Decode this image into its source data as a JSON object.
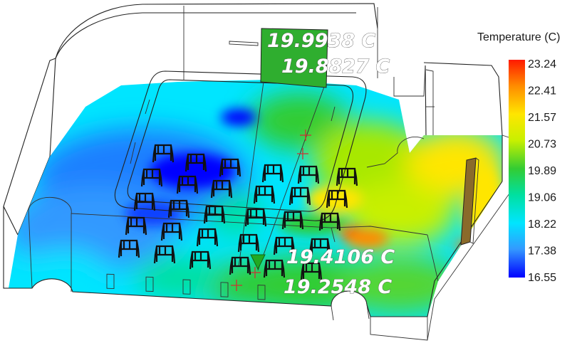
{
  "legend": {
    "title": "Temperature (C)",
    "ticks": [
      "23.24",
      "22.41",
      "21.57",
      "20.73",
      "19.89",
      "19.06",
      "18.22",
      "17.38",
      "16.55"
    ],
    "colors": [
      "#ff1a00",
      "#ff8c00",
      "#ffe600",
      "#c8f000",
      "#33cc33",
      "#00e0a0",
      "#00e5ff",
      "#3399ff",
      "#0000ff"
    ]
  },
  "probes": {
    "top1": "19.9938 C",
    "top2": "19.8827 C",
    "bottom1": "19.4106 C",
    "bottom2": "19.2548 C"
  },
  "scene": {
    "colors": {
      "cold": "#0000ff",
      "blue": "#1f7fff",
      "cyan": "#00e5ff",
      "green": "#33cc33",
      "yellow": "#ffe600",
      "hot": "#ff1a00",
      "diffuser": "#2fae2f",
      "heater": "#8a6a2a"
    }
  }
}
